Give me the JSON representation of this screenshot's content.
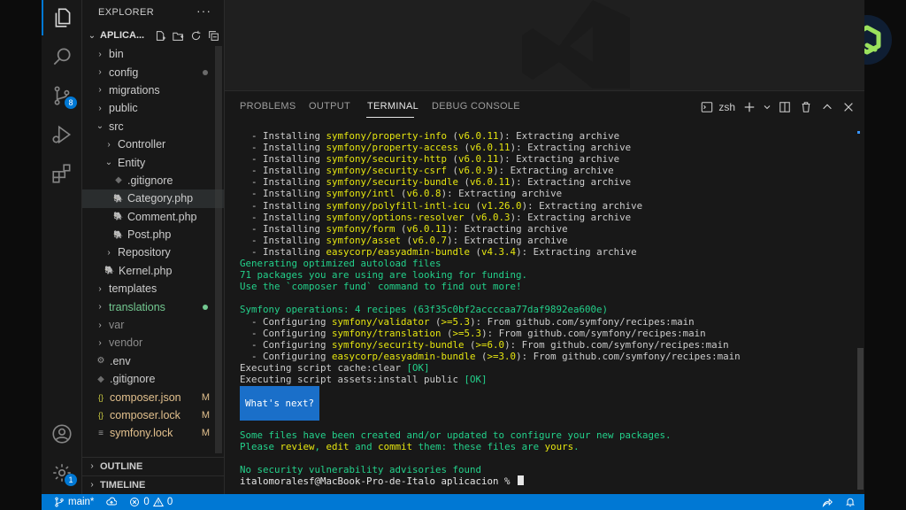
{
  "sidebar": {
    "title": "EXPLORER",
    "more": "···",
    "folder_name": "APLICA...",
    "items": [
      {
        "name": "bin",
        "kind": "folder",
        "state": "normal"
      },
      {
        "name": "config",
        "kind": "folder",
        "state": "mod-dot"
      },
      {
        "name": "migrations",
        "kind": "folder",
        "state": "normal"
      },
      {
        "name": "public",
        "kind": "folder",
        "state": "normal"
      },
      {
        "name": "src",
        "kind": "folder-open",
        "state": "normal"
      },
      {
        "name": "Controller",
        "kind": "folder",
        "state": "normal"
      },
      {
        "name": "Entity",
        "kind": "folder-open",
        "state": "normal"
      },
      {
        "name": ".gitignore",
        "kind": "git",
        "state": "normal"
      },
      {
        "name": "Category.php",
        "kind": "php",
        "state": "selected"
      },
      {
        "name": "Comment.php",
        "kind": "php",
        "state": "normal"
      },
      {
        "name": "Post.php",
        "kind": "php",
        "state": "normal"
      },
      {
        "name": "Repository",
        "kind": "folder",
        "state": "normal"
      },
      {
        "name": "Kernel.php",
        "kind": "php",
        "state": "normal"
      },
      {
        "name": "templates",
        "kind": "folder",
        "state": "normal"
      },
      {
        "name": "translations",
        "kind": "folder",
        "state": "added"
      },
      {
        "name": "var",
        "kind": "folder",
        "state": "dim"
      },
      {
        "name": "vendor",
        "kind": "folder",
        "state": "dim"
      },
      {
        "name": ".env",
        "kind": "gear",
        "state": "normal"
      },
      {
        "name": ".gitignore",
        "kind": "git",
        "state": "normal"
      },
      {
        "name": "composer.json",
        "kind": "json",
        "state": "modified",
        "mark": "M"
      },
      {
        "name": "composer.lock",
        "kind": "json",
        "state": "modified",
        "mark": "M"
      },
      {
        "name": "symfony.lock",
        "kind": "lock",
        "state": "modified",
        "mark": "M"
      }
    ],
    "outline": "OUTLINE",
    "timeline": "TIMELINE"
  },
  "activity": {
    "source_control_badge": "8",
    "accounts_badge": "1"
  },
  "panel": {
    "tabs": [
      "PROBLEMS",
      "OUTPUT",
      "TERMINAL",
      "DEBUG CONSOLE"
    ],
    "active_tab": "TERMINAL",
    "shell": "zsh"
  },
  "terminal": {
    "lines": [
      [
        {
          "t": "  - Installing "
        },
        {
          "t": "symfony/property-info",
          "c": "y"
        },
        {
          "t": " ("
        },
        {
          "t": "v6.0.11",
          "c": "y"
        },
        {
          "t": "): Extracting archive"
        }
      ],
      [
        {
          "t": "  - Installing "
        },
        {
          "t": "symfony/property-access",
          "c": "y"
        },
        {
          "t": " ("
        },
        {
          "t": "v6.0.11",
          "c": "y"
        },
        {
          "t": "): Extracting archive"
        }
      ],
      [
        {
          "t": "  - Installing "
        },
        {
          "t": "symfony/security-http",
          "c": "y"
        },
        {
          "t": " ("
        },
        {
          "t": "v6.0.11",
          "c": "y"
        },
        {
          "t": "): Extracting archive"
        }
      ],
      [
        {
          "t": "  - Installing "
        },
        {
          "t": "symfony/security-csrf",
          "c": "y"
        },
        {
          "t": " ("
        },
        {
          "t": "v6.0.9",
          "c": "y"
        },
        {
          "t": "): Extracting archive"
        }
      ],
      [
        {
          "t": "  - Installing "
        },
        {
          "t": "symfony/security-bundle",
          "c": "y"
        },
        {
          "t": " ("
        },
        {
          "t": "v6.0.11",
          "c": "y"
        },
        {
          "t": "): Extracting archive"
        }
      ],
      [
        {
          "t": "  - Installing "
        },
        {
          "t": "symfony/intl",
          "c": "y"
        },
        {
          "t": " ("
        },
        {
          "t": "v6.0.8",
          "c": "y"
        },
        {
          "t": "): Extracting archive"
        }
      ],
      [
        {
          "t": "  - Installing "
        },
        {
          "t": "symfony/polyfill-intl-icu",
          "c": "y"
        },
        {
          "t": " ("
        },
        {
          "t": "v1.26.0",
          "c": "y"
        },
        {
          "t": "): Extracting archive"
        }
      ],
      [
        {
          "t": "  - Installing "
        },
        {
          "t": "symfony/options-resolver",
          "c": "y"
        },
        {
          "t": " ("
        },
        {
          "t": "v6.0.3",
          "c": "y"
        },
        {
          "t": "): Extracting archive"
        }
      ],
      [
        {
          "t": "  - Installing "
        },
        {
          "t": "symfony/form",
          "c": "y"
        },
        {
          "t": " ("
        },
        {
          "t": "v6.0.11",
          "c": "y"
        },
        {
          "t": "): Extracting archive"
        }
      ],
      [
        {
          "t": "  - Installing "
        },
        {
          "t": "symfony/asset",
          "c": "y"
        },
        {
          "t": " ("
        },
        {
          "t": "v6.0.7",
          "c": "y"
        },
        {
          "t": "): Extracting archive"
        }
      ],
      [
        {
          "t": "  - Installing "
        },
        {
          "t": "easycorp/easyadmin-bundle",
          "c": "y"
        },
        {
          "t": " ("
        },
        {
          "t": "v4.3.4",
          "c": "y"
        },
        {
          "t": "): Extracting archive"
        }
      ],
      [
        {
          "t": "Generating optimized autoload files",
          "c": "g"
        }
      ],
      [
        {
          "t": "71 packages you are using are looking for funding.",
          "c": "g"
        }
      ],
      [
        {
          "t": "Use the `composer fund` command to find out more!",
          "c": "g"
        }
      ],
      [
        {
          "t": ""
        }
      ],
      [
        {
          "t": "Symfony operations: 4 recipes (63f35c0bf2accccaa77daf9892ea600e)",
          "c": "g"
        }
      ],
      [
        {
          "t": "  - Configuring "
        },
        {
          "t": "symfony/validator",
          "c": "y"
        },
        {
          "t": " ("
        },
        {
          "t": ">=5.3",
          "c": "y"
        },
        {
          "t": "): From github.com/symfony/recipes:main"
        }
      ],
      [
        {
          "t": "  - Configuring "
        },
        {
          "t": "symfony/translation",
          "c": "y"
        },
        {
          "t": " ("
        },
        {
          "t": ">=5.3",
          "c": "y"
        },
        {
          "t": "): From github.com/symfony/recipes:main"
        }
      ],
      [
        {
          "t": "  - Configuring "
        },
        {
          "t": "symfony/security-bundle",
          "c": "y"
        },
        {
          "t": " ("
        },
        {
          "t": ">=6.0",
          "c": "y"
        },
        {
          "t": "): From github.com/symfony/recipes:main"
        }
      ],
      [
        {
          "t": "  - Configuring "
        },
        {
          "t": "easycorp/easyadmin-bundle",
          "c": "y"
        },
        {
          "t": " ("
        },
        {
          "t": ">=3.0",
          "c": "y"
        },
        {
          "t": "): From github.com/symfony/recipes:main"
        }
      ],
      [
        {
          "t": "Executing script cache:clear "
        },
        {
          "t": "[OK]",
          "c": "g"
        }
      ],
      [
        {
          "t": "Executing script assets:install public "
        },
        {
          "t": "[OK]",
          "c": "g"
        }
      ]
    ],
    "whats_next": "What's next?",
    "after_lines": [
      [
        {
          "t": "Some files have been created and/or updated to configure your new packages.",
          "c": "g"
        }
      ],
      [
        {
          "t": "Please ",
          "c": "g"
        },
        {
          "t": "review",
          "c": "y"
        },
        {
          "t": ", ",
          "c": "g"
        },
        {
          "t": "edit",
          "c": "y"
        },
        {
          "t": " and ",
          "c": "g"
        },
        {
          "t": "commit",
          "c": "y"
        },
        {
          "t": " them: these files are ",
          "c": "g"
        },
        {
          "t": "yours",
          "c": "y"
        },
        {
          "t": ".",
          "c": "g"
        }
      ],
      [
        {
          "t": ""
        }
      ],
      [
        {
          "t": "No security vulnerability advisories found",
          "c": "g"
        }
      ]
    ],
    "prompt": "italomoralesf@MacBook-Pro-de-Italo aplicacion % "
  },
  "statusbar": {
    "branch": "main*",
    "errors": "0",
    "warnings": "0"
  },
  "colors": {
    "accent": "#0078d4",
    "term_yellow": "#e5e510",
    "term_green": "#23d18b"
  }
}
